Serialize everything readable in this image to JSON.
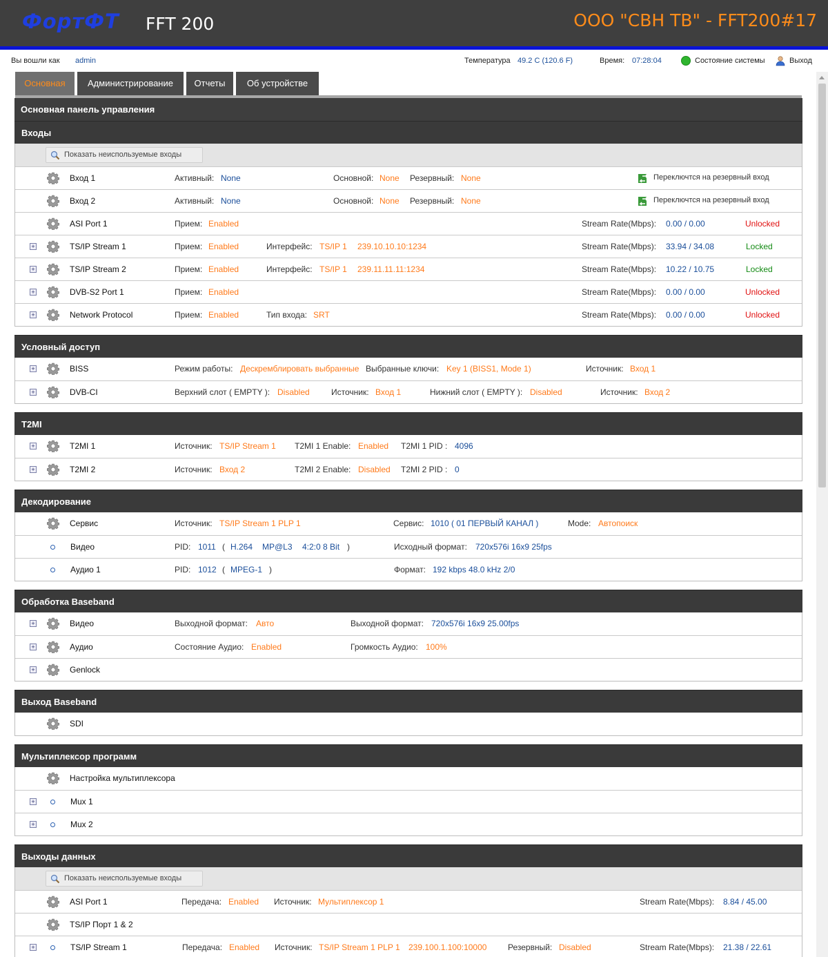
{
  "header": {
    "logo": "ФортФТ",
    "product": "FFT 200",
    "company": "ООО \"СВН ТВ\" - FFT200#17"
  },
  "status": {
    "logged_in_label": "Вы вошли как",
    "user": "admin",
    "temp_label": "Температура",
    "temp_value": "49.2 C (120.6 F)",
    "time_label": "Время:",
    "time_value": "07:28:04",
    "system_state": "Состояние системы",
    "logout": "Выход"
  },
  "tabs": [
    "Основная",
    "Администрирование",
    "Отчеты",
    "Об устройстве"
  ],
  "panel_title": "Основная панель управления",
  "show_unused": "Показать неиспользуемые входы",
  "inputs": {
    "title": "Входы",
    "vhod1": {
      "name": "Вход 1",
      "active_lbl": "Активный:",
      "active": "None",
      "main_lbl": "Основной:",
      "main": "None",
      "backup_lbl": "Резервный:",
      "backup": "None",
      "switch": "Переключтся на резервный вход"
    },
    "vhod2": {
      "name": "Вход 2",
      "active_lbl": "Активный:",
      "active": "None",
      "main_lbl": "Основной:",
      "main": "None",
      "backup_lbl": "Резервный:",
      "backup": "None",
      "switch": "Переключтся на резервный вход"
    },
    "asi": {
      "name": "ASI Port 1",
      "rx_lbl": "Прием:",
      "rx": "Enabled",
      "rate_lbl": "Stream Rate(Mbps):",
      "rate": "0.00 / 0.00",
      "lock": "Unlocked"
    },
    "ts1": {
      "name": "TS/IP Stream 1",
      "rx_lbl": "Прием:",
      "rx": "Enabled",
      "if_lbl": "Интерфейс:",
      "if": "TS/IP 1",
      "addr": "239.10.10.10:1234",
      "rate_lbl": "Stream Rate(Mbps):",
      "rate": "33.94 / 34.08",
      "lock": "Locked"
    },
    "ts2": {
      "name": "TS/IP Stream 2",
      "rx_lbl": "Прием:",
      "rx": "Enabled",
      "if_lbl": "Интерфейс:",
      "if": "TS/IP 1",
      "addr": "239.11.11.11:1234",
      "rate_lbl": "Stream Rate(Mbps):",
      "rate": "10.22 / 10.75",
      "lock": "Locked"
    },
    "dvbs2": {
      "name": "DVB-S2 Port 1",
      "rx_lbl": "Прием:",
      "rx": "Enabled",
      "rate_lbl": "Stream Rate(Mbps):",
      "rate": "0.00 / 0.00",
      "lock": "Unlocked"
    },
    "net": {
      "name": "Network Protocol",
      "rx_lbl": "Прием:",
      "rx": "Enabled",
      "type_lbl": "Тип входа:",
      "type": "SRT",
      "rate_lbl": "Stream Rate(Mbps):",
      "rate": "0.00 / 0.00",
      "lock": "Unlocked"
    }
  },
  "ca": {
    "title": "Условный доступ",
    "biss": {
      "name": "BISS",
      "mode_lbl": "Режим работы:",
      "mode": "Дескремблировать выбранные",
      "keys_lbl": "Выбранные ключи:",
      "keys": "Key 1 (BISS1, Mode 1)",
      "src_lbl": "Источник:",
      "src": "Вход 1"
    },
    "dvbci": {
      "name": "DVB-CI",
      "top_lbl": "Верхний слот ( EMPTY ):",
      "top": "Disabled",
      "src1_lbl": "Источник:",
      "src1": "Вход 1",
      "bottom_lbl": "Нижний слот ( EMPTY ):",
      "bottom": "Disabled",
      "src2_lbl": "Источник:",
      "src2": "Вход 2"
    }
  },
  "t2mi": {
    "title": "T2MI",
    "r1": {
      "name": "T2MI 1",
      "src_lbl": "Источник:",
      "src": "TS/IP Stream 1",
      "en_lbl": "T2MI 1 Enable:",
      "en": "Enabled",
      "pid_lbl": "T2MI 1 PID :",
      "pid": "4096"
    },
    "r2": {
      "name": "T2MI 2",
      "src_lbl": "Источник:",
      "src": "Вход 2",
      "en_lbl": "T2MI 2 Enable:",
      "en": "Disabled",
      "pid_lbl": "T2MI 2 PID :",
      "pid": "0"
    }
  },
  "decode": {
    "title": "Декодирование",
    "service": {
      "name": "Сервис",
      "src_lbl": "Источник:",
      "src": "TS/IP Stream 1 PLP 1",
      "svc_lbl": "Сервис:",
      "svc": "1010 ( 01 ПЕРВЫЙ КАНАЛ )",
      "mode_lbl": "Mode:",
      "mode": "Автопоиск"
    },
    "video": {
      "name": "Видео",
      "pid_lbl": "PID:",
      "pid": "1011",
      "p_open": "(",
      "codec": "H.264",
      "profile": "MP@L3",
      "chroma": "4:2:0 8 Bit",
      "p_close": ")",
      "fmt_lbl": "Исходный формат:",
      "fmt": "720x576i 16x9 25fps"
    },
    "audio": {
      "name": "Аудио 1",
      "pid_lbl": "PID:",
      "pid": "1012",
      "p_open": "(",
      "codec": "MPEG-1",
      "p_close": ")",
      "fmt_lbl": "Формат:",
      "fmt": "192 kbps  48.0 kHz  2/0"
    }
  },
  "baseband": {
    "title": "Обработка Baseband",
    "video": {
      "name": "Видео",
      "out_lbl": "Выходной формат:",
      "out": "Авто",
      "out2_lbl": "Выходной формат:",
      "out2": "720x576i 16x9 25.00fps"
    },
    "audio": {
      "name": "Аудио",
      "st_lbl": "Состояние Аудио:",
      "st": "Enabled",
      "vol_lbl": "Громкость Аудио:",
      "vol": "100%"
    },
    "genlock": {
      "name": "Genlock"
    }
  },
  "bb_out": {
    "title": "Выход Baseband",
    "sdi": "SDI"
  },
  "mux": {
    "title": "Мультиплексор программ",
    "setup": "Настройка мультиплексора",
    "mux1": "Mux 1",
    "mux2": "Mux 2"
  },
  "data_out": {
    "title": "Выходы данных",
    "asi": {
      "name": "ASI Port 1",
      "tx_lbl": "Передача:",
      "tx": "Enabled",
      "src_lbl": "Источник:",
      "src": "Мультиплексор 1",
      "rate_lbl": "Stream Rate(Mbps):",
      "rate": "8.84 / 45.00"
    },
    "tsports": {
      "name": "TS/IP Порт 1 & 2"
    },
    "ts1": {
      "name": "TS/IP Stream 1",
      "tx_lbl": "Передача:",
      "tx": "Enabled",
      "src_lbl": "Источник:",
      "src": "TS/IP Stream 1 PLP 1",
      "addr": "239.100.1.100:10000",
      "bk_lbl": "Резервный:",
      "bk": "Disabled",
      "rate_lbl": "Stream Rate(Mbps):",
      "rate": "21.38 / 22.61"
    }
  },
  "colors": {
    "accent": "#ff7a1a",
    "header_bg": "#3f3f3f",
    "blue_bar": "#0a14d8",
    "locked": "#138a13",
    "unlocked": "#e01010",
    "value_blue": "#1a4e9a"
  }
}
